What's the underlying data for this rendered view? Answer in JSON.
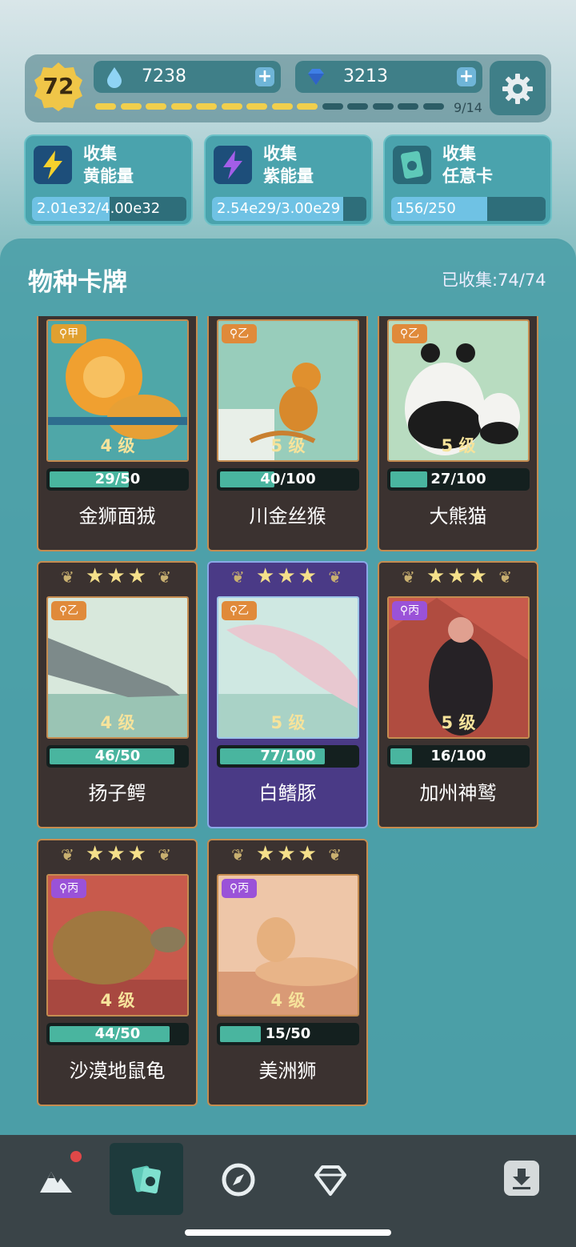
{
  "header": {
    "level": "72",
    "water": {
      "value": "7238",
      "plus": "+"
    },
    "diamonds": {
      "value": "3213",
      "plus": "+"
    },
    "progress": {
      "current": 9,
      "total": 14,
      "label": "9/14"
    }
  },
  "quests": [
    {
      "title": "收集\n黄能量",
      "progress_text": "2.01e32/4.00e32",
      "fraction": 0.5,
      "icon": "lightning-yellow-icon"
    },
    {
      "title": "收集\n紫能量",
      "progress_text": "2.54e29/3.00e29",
      "fraction": 0.85,
      "icon": "lightning-purple-icon"
    },
    {
      "title": "收集\n任意卡",
      "progress_text": "156/250",
      "fraction": 0.62,
      "icon": "card-icon"
    }
  ],
  "collection": {
    "title": "物种卡牌",
    "count_label": "已收集:74/74"
  },
  "cards": [
    {
      "name": "金狮面狨",
      "tag": "甲",
      "level": "4 级",
      "progress": "29/50",
      "fraction": 0.58,
      "stars": false,
      "rarity_color": "#e0a030"
    },
    {
      "name": "川金丝猴",
      "tag": "乙",
      "level": "5 级",
      "progress": "40/100",
      "fraction": 0.4,
      "stars": false,
      "rarity_color": "#e08a3a"
    },
    {
      "name": "大熊猫",
      "tag": "乙",
      "level": "5 级",
      "progress": "27/100",
      "fraction": 0.27,
      "stars": false,
      "rarity_color": "#e08a3a"
    },
    {
      "name": "扬子鳄",
      "tag": "乙",
      "level": "4 级",
      "progress": "46/50",
      "fraction": 0.92,
      "stars": true,
      "rarity_color": "#e08a3a"
    },
    {
      "name": "白鳍豚",
      "tag": "乙",
      "level": "5 级",
      "progress": "77/100",
      "fraction": 0.77,
      "stars": true,
      "rarity_color": "#e08a3a",
      "highlight": true
    },
    {
      "name": "加州神鹫",
      "tag": "丙",
      "level": "5 级",
      "progress": "16/100",
      "fraction": 0.16,
      "stars": true,
      "rarity_color": "#9a52d8"
    },
    {
      "name": "沙漠地鼠龟",
      "tag": "丙",
      "level": "4 级",
      "progress": "44/50",
      "fraction": 0.88,
      "stars": true,
      "rarity_color": "#9a52d8"
    },
    {
      "name": "美洲狮",
      "tag": "丙",
      "level": "4 级",
      "progress": "15/50",
      "fraction": 0.3,
      "stars": true,
      "rarity_color": "#9a52d8"
    }
  ],
  "stars_text": "★★★",
  "nav": {
    "items": [
      "mountain-icon",
      "cards-icon",
      "compass-icon",
      "diamond-icon"
    ],
    "active_index": 1,
    "download": "download-icon"
  }
}
